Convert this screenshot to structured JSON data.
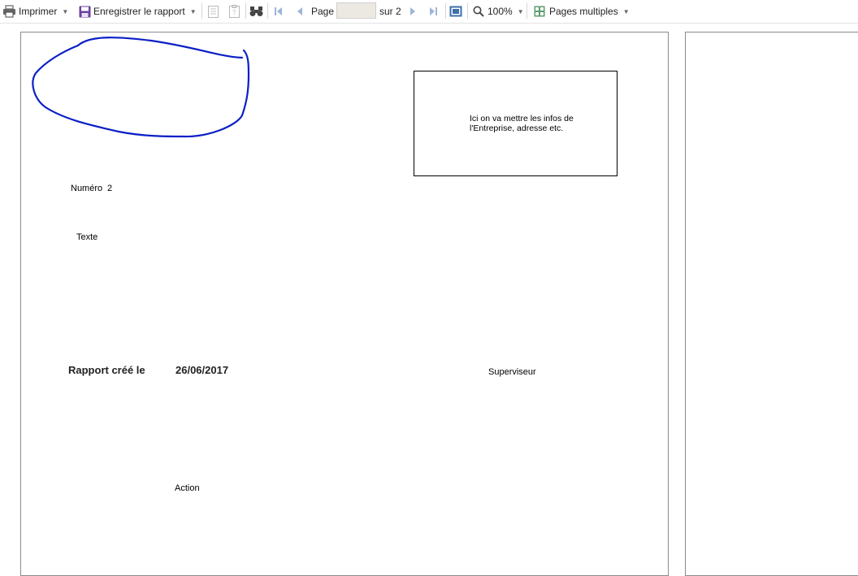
{
  "toolbar": {
    "print_label": "Imprimer",
    "save_label": "Enregistrer le rapport",
    "page_label": "Page",
    "page_input_value": "",
    "of_label": "sur 2",
    "zoom_label": "100%",
    "multi_pages_label": "Pages multiples"
  },
  "report": {
    "info_box_text": "Ici on va mettre les infos de l'Entreprise, adresse etc.",
    "numero_label": "Numéro",
    "numero_value": "2",
    "texte_label": "Texte",
    "created_label": "Rapport créé le",
    "created_date": "26/06/2017",
    "supervisor_label": "Superviseur",
    "action_label": "Action"
  },
  "colors": {
    "annotation_stroke": "#0a1fc6",
    "save_icon": "#6b3fa0",
    "nav_icon": "#9cb6d8",
    "page_border": "#8c8c8c"
  }
}
